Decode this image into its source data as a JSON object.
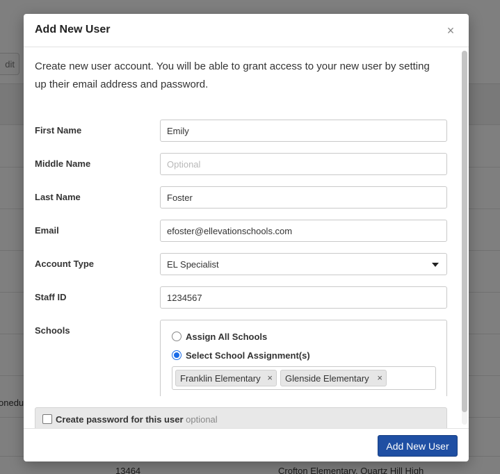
{
  "background": {
    "edit_label": "dit",
    "truncated_text": "oneduc",
    "row_id": "13464",
    "row_schools": "Crofton Elementary, Quartz Hill High"
  },
  "modal": {
    "title": "Add New User",
    "close_symbol": "×",
    "intro": "Create new user account. You will be able to grant access to your new user by setting up their email address and password.",
    "fields": {
      "first_name": {
        "label": "First Name",
        "value": "Emily",
        "placeholder": ""
      },
      "middle_name": {
        "label": "Middle Name",
        "value": "",
        "placeholder": "Optional"
      },
      "last_name": {
        "label": "Last Name",
        "value": "Foster",
        "placeholder": ""
      },
      "email": {
        "label": "Email",
        "value": "efoster@ellevationschools.com",
        "placeholder": ""
      },
      "account_type": {
        "label": "Account Type",
        "value": "EL Specialist"
      },
      "staff_id": {
        "label": "Staff ID",
        "value": "1234567",
        "placeholder": ""
      }
    },
    "schools": {
      "label": "Schools",
      "option_all": "Assign All Schools",
      "option_select": "Select School Assignment(s)",
      "selected_option": "select",
      "tags": [
        "Franklin Elementary",
        "Glenside Elementary"
      ],
      "remove_symbol": "×"
    },
    "password": {
      "label": "Create password for this user",
      "optional": "optional",
      "checked": false
    },
    "submit_label": "Add New User"
  },
  "colors": {
    "primary_button": "#1f4fa3",
    "radio_accent": "#1a6ce8"
  }
}
